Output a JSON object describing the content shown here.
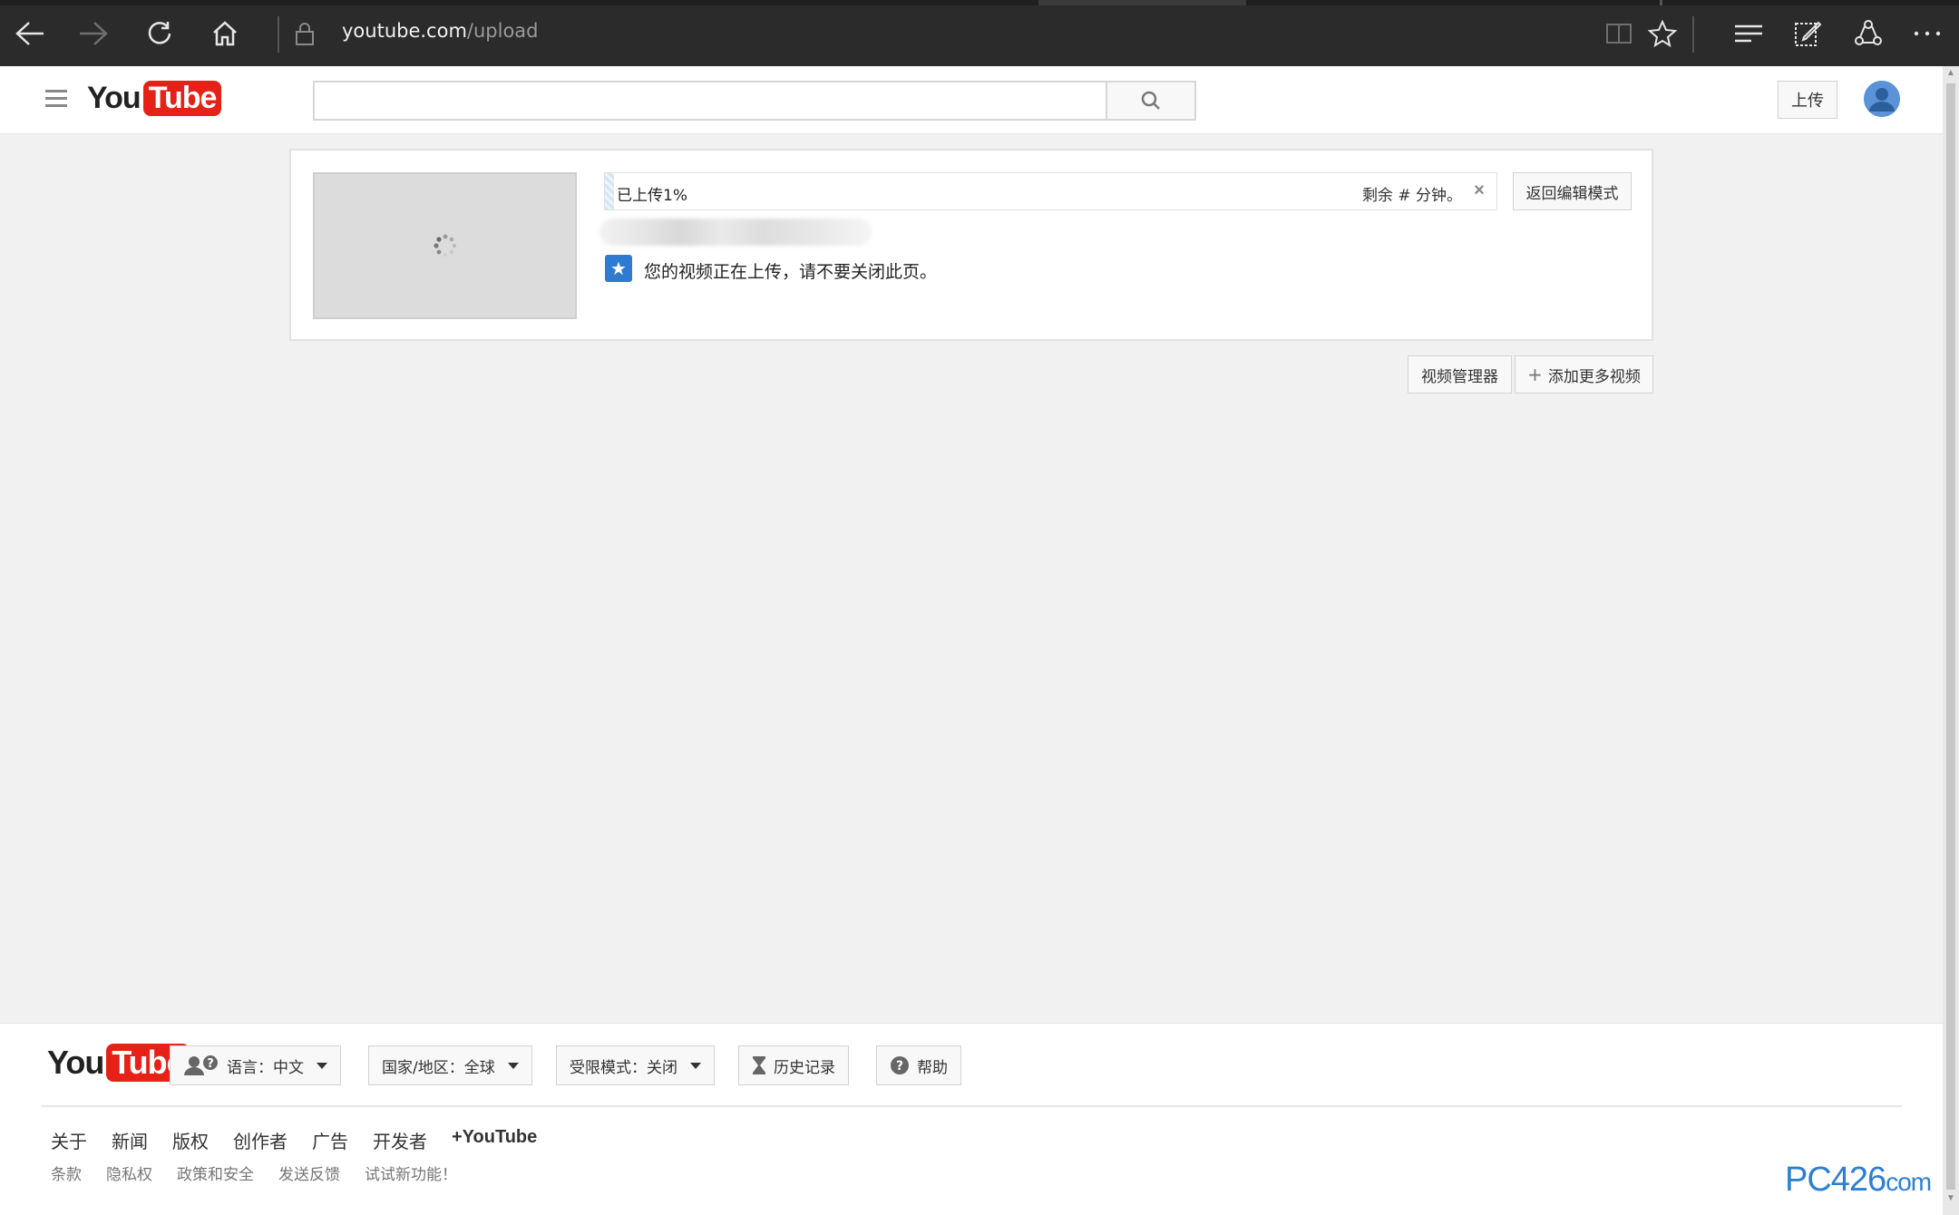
{
  "browser": {
    "address_host": "youtube.com",
    "address_path": "/upload"
  },
  "header": {
    "logo_you": "You",
    "logo_tube": "Tube",
    "search_placeholder": "",
    "upload_label": "上传"
  },
  "upload": {
    "progress_label": "已上传1%",
    "progress_percent": 1,
    "remaining_text": "剩余 # 分钟。",
    "close_symbol": "×",
    "back_to_edit_label": "返回编辑模式",
    "status_text": "您的视频正在上传，请不要关闭此页。"
  },
  "actions": {
    "video_manager_label": "视频管理器",
    "add_more_label": "添加更多视频"
  },
  "footer": {
    "logo_you": "You",
    "logo_tube": "Tube",
    "language_label": "语言：中文",
    "country_label": "国家/地区：全球",
    "restricted_label": "受限模式：关闭",
    "history_label": "历史记录",
    "help_label": "帮助",
    "links": [
      "关于",
      "新闻",
      "版权",
      "创作者",
      "广告",
      "开发者",
      "+YouTube"
    ],
    "sublinks": [
      "条款",
      "隐私权",
      "政策和安全",
      "发送反馈",
      "试试新功能！"
    ]
  },
  "watermark": {
    "main": "PC426",
    "tail": "com"
  },
  "colors": {
    "brand_red": "#e62117",
    "accent_blue": "#2f7bd1"
  }
}
